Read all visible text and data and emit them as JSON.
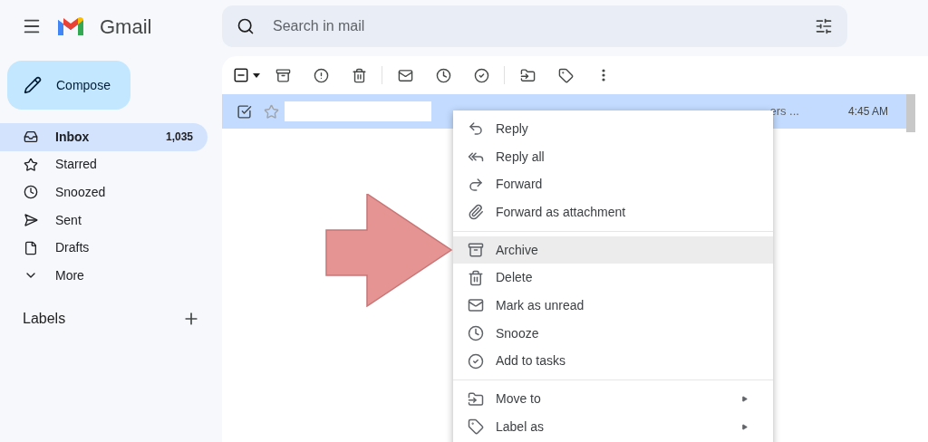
{
  "app": {
    "name": "Gmail"
  },
  "search": {
    "placeholder": "Search in mail"
  },
  "compose": {
    "label": "Compose"
  },
  "sidebar": {
    "items": [
      {
        "label": "Inbox",
        "count": "1,035",
        "selected": true
      },
      {
        "label": "Starred",
        "selected": false
      },
      {
        "label": "Snoozed",
        "selected": false
      },
      {
        "label": "Sent",
        "selected": false
      },
      {
        "label": "Drafts",
        "selected": false
      },
      {
        "label": "More",
        "selected": false
      }
    ],
    "labels_heading": "Labels"
  },
  "toolbar": {
    "select_all": {
      "checked": true,
      "indeterminate": true
    }
  },
  "messages": [
    {
      "selected": true,
      "starred": false,
      "snippet": "ers ...",
      "time": "4:45 AM"
    }
  ],
  "context_menu": {
    "groups": [
      [
        {
          "label": "Reply",
          "highlighted": false,
          "submenu": false
        },
        {
          "label": "Reply all",
          "highlighted": false,
          "submenu": false
        },
        {
          "label": "Forward",
          "highlighted": false,
          "submenu": false
        },
        {
          "label": "Forward as attachment",
          "highlighted": false,
          "submenu": false
        }
      ],
      [
        {
          "label": "Archive",
          "highlighted": true,
          "submenu": false
        },
        {
          "label": "Delete",
          "highlighted": false,
          "submenu": false
        },
        {
          "label": "Mark as unread",
          "highlighted": false,
          "submenu": false
        },
        {
          "label": "Snooze",
          "highlighted": false,
          "submenu": false
        },
        {
          "label": "Add to tasks",
          "highlighted": false,
          "submenu": false
        }
      ],
      [
        {
          "label": "Move to",
          "highlighted": false,
          "submenu": true
        },
        {
          "label": "Label as",
          "highlighted": false,
          "submenu": true
        }
      ]
    ]
  }
}
